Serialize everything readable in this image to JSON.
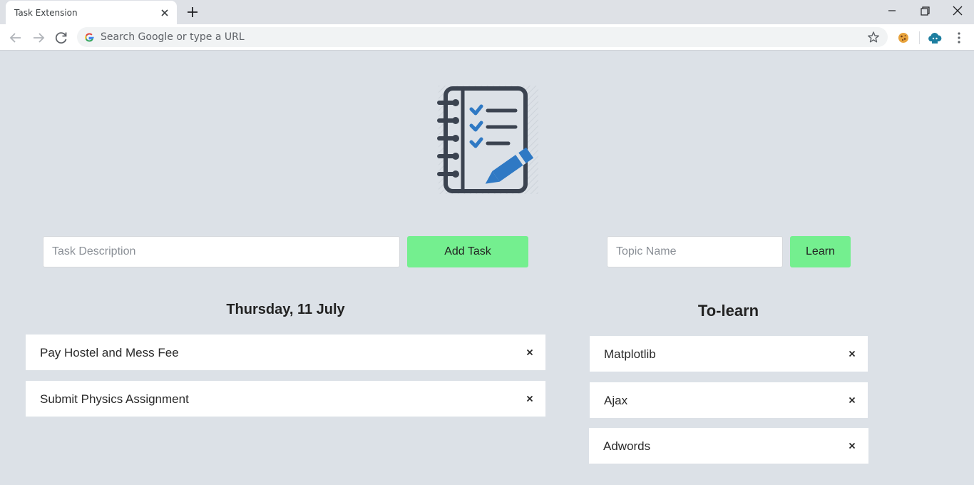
{
  "browser": {
    "tab_title": "Task Extension",
    "omnibox_placeholder": "Search Google or type a URL",
    "icons": [
      "back-arrow-icon",
      "forward-arrow-icon",
      "reload-icon",
      "google-g-icon",
      "star-icon",
      "cookie-extension-icon",
      "cloud-extension-icon",
      "kebab-menu-icon"
    ]
  },
  "app": {
    "task_placeholder": "Task Description",
    "add_task_label": "Add Task",
    "topic_placeholder": "Topic Name",
    "learn_label": "Learn",
    "date_heading": "Thursday, 11 July",
    "learn_heading": "To-learn",
    "tasks": [
      {
        "text": "Pay Hostel and Mess Fee",
        "remove": "×"
      },
      {
        "text": "Submit Physics Assignment",
        "remove": "×"
      }
    ],
    "topics": [
      {
        "text": "Matplotlib",
        "remove": "×"
      },
      {
        "text": "Ajax",
        "remove": "×"
      },
      {
        "text": "Adwords",
        "remove": "×"
      }
    ],
    "accent_color": "#74ef8f",
    "logo_blue": "#2f79c4",
    "logo_dark": "#3b4350"
  }
}
